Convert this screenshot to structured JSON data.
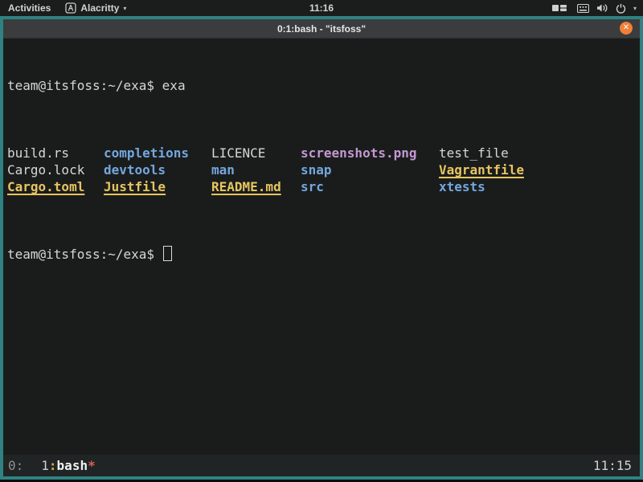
{
  "topbar": {
    "activities": "Activities",
    "app_name": "Alacritty",
    "app_menu_chevron": "▾",
    "clock": "11:16",
    "tray_chevron": "▾"
  },
  "window": {
    "title": "0:1:bash - \"itsfoss\"",
    "close_glyph": "✕"
  },
  "terminal": {
    "prompt": "team@itsfoss:~/exa$",
    "command": "exa",
    "prompt2": "team@itsfoss:~/exa$",
    "rows": [
      [
        {
          "name": "build.rs",
          "type": "file"
        },
        {
          "name": "completions",
          "type": "dir"
        },
        {
          "name": "LICENCE",
          "type": "file"
        },
        {
          "name": "screenshots.png",
          "type": "image"
        },
        {
          "name": "test_file",
          "type": "file"
        }
      ],
      [
        {
          "name": "Cargo.lock",
          "type": "file"
        },
        {
          "name": "devtools",
          "type": "dir"
        },
        {
          "name": "man",
          "type": "dir"
        },
        {
          "name": "snap",
          "type": "dir"
        },
        {
          "name": "Vagrantfile",
          "type": "special"
        }
      ],
      [
        {
          "name": "Cargo.toml",
          "type": "special"
        },
        {
          "name": "Justfile",
          "type": "special"
        },
        {
          "name": "README.md",
          "type": "special"
        },
        {
          "name": "src",
          "type": "dir"
        },
        {
          "name": "xtests",
          "type": "dir"
        }
      ]
    ]
  },
  "statusbar": {
    "session": "0:",
    "window_index": "1",
    "window_colon": ":",
    "window_name": "bash",
    "window_flag": "*",
    "clock": "11:15"
  },
  "colors": {
    "window_border_teal": "#2f8282",
    "directory_blue": "#74a7dd",
    "special_yellow": "#e7c55f",
    "image_purple": "#c398d2",
    "flag_red": "#e05c5c",
    "close_button_orange": "#ee8137",
    "terminal_background": "#1a1c1c",
    "titlebar_gray": "#3b3c3d"
  }
}
